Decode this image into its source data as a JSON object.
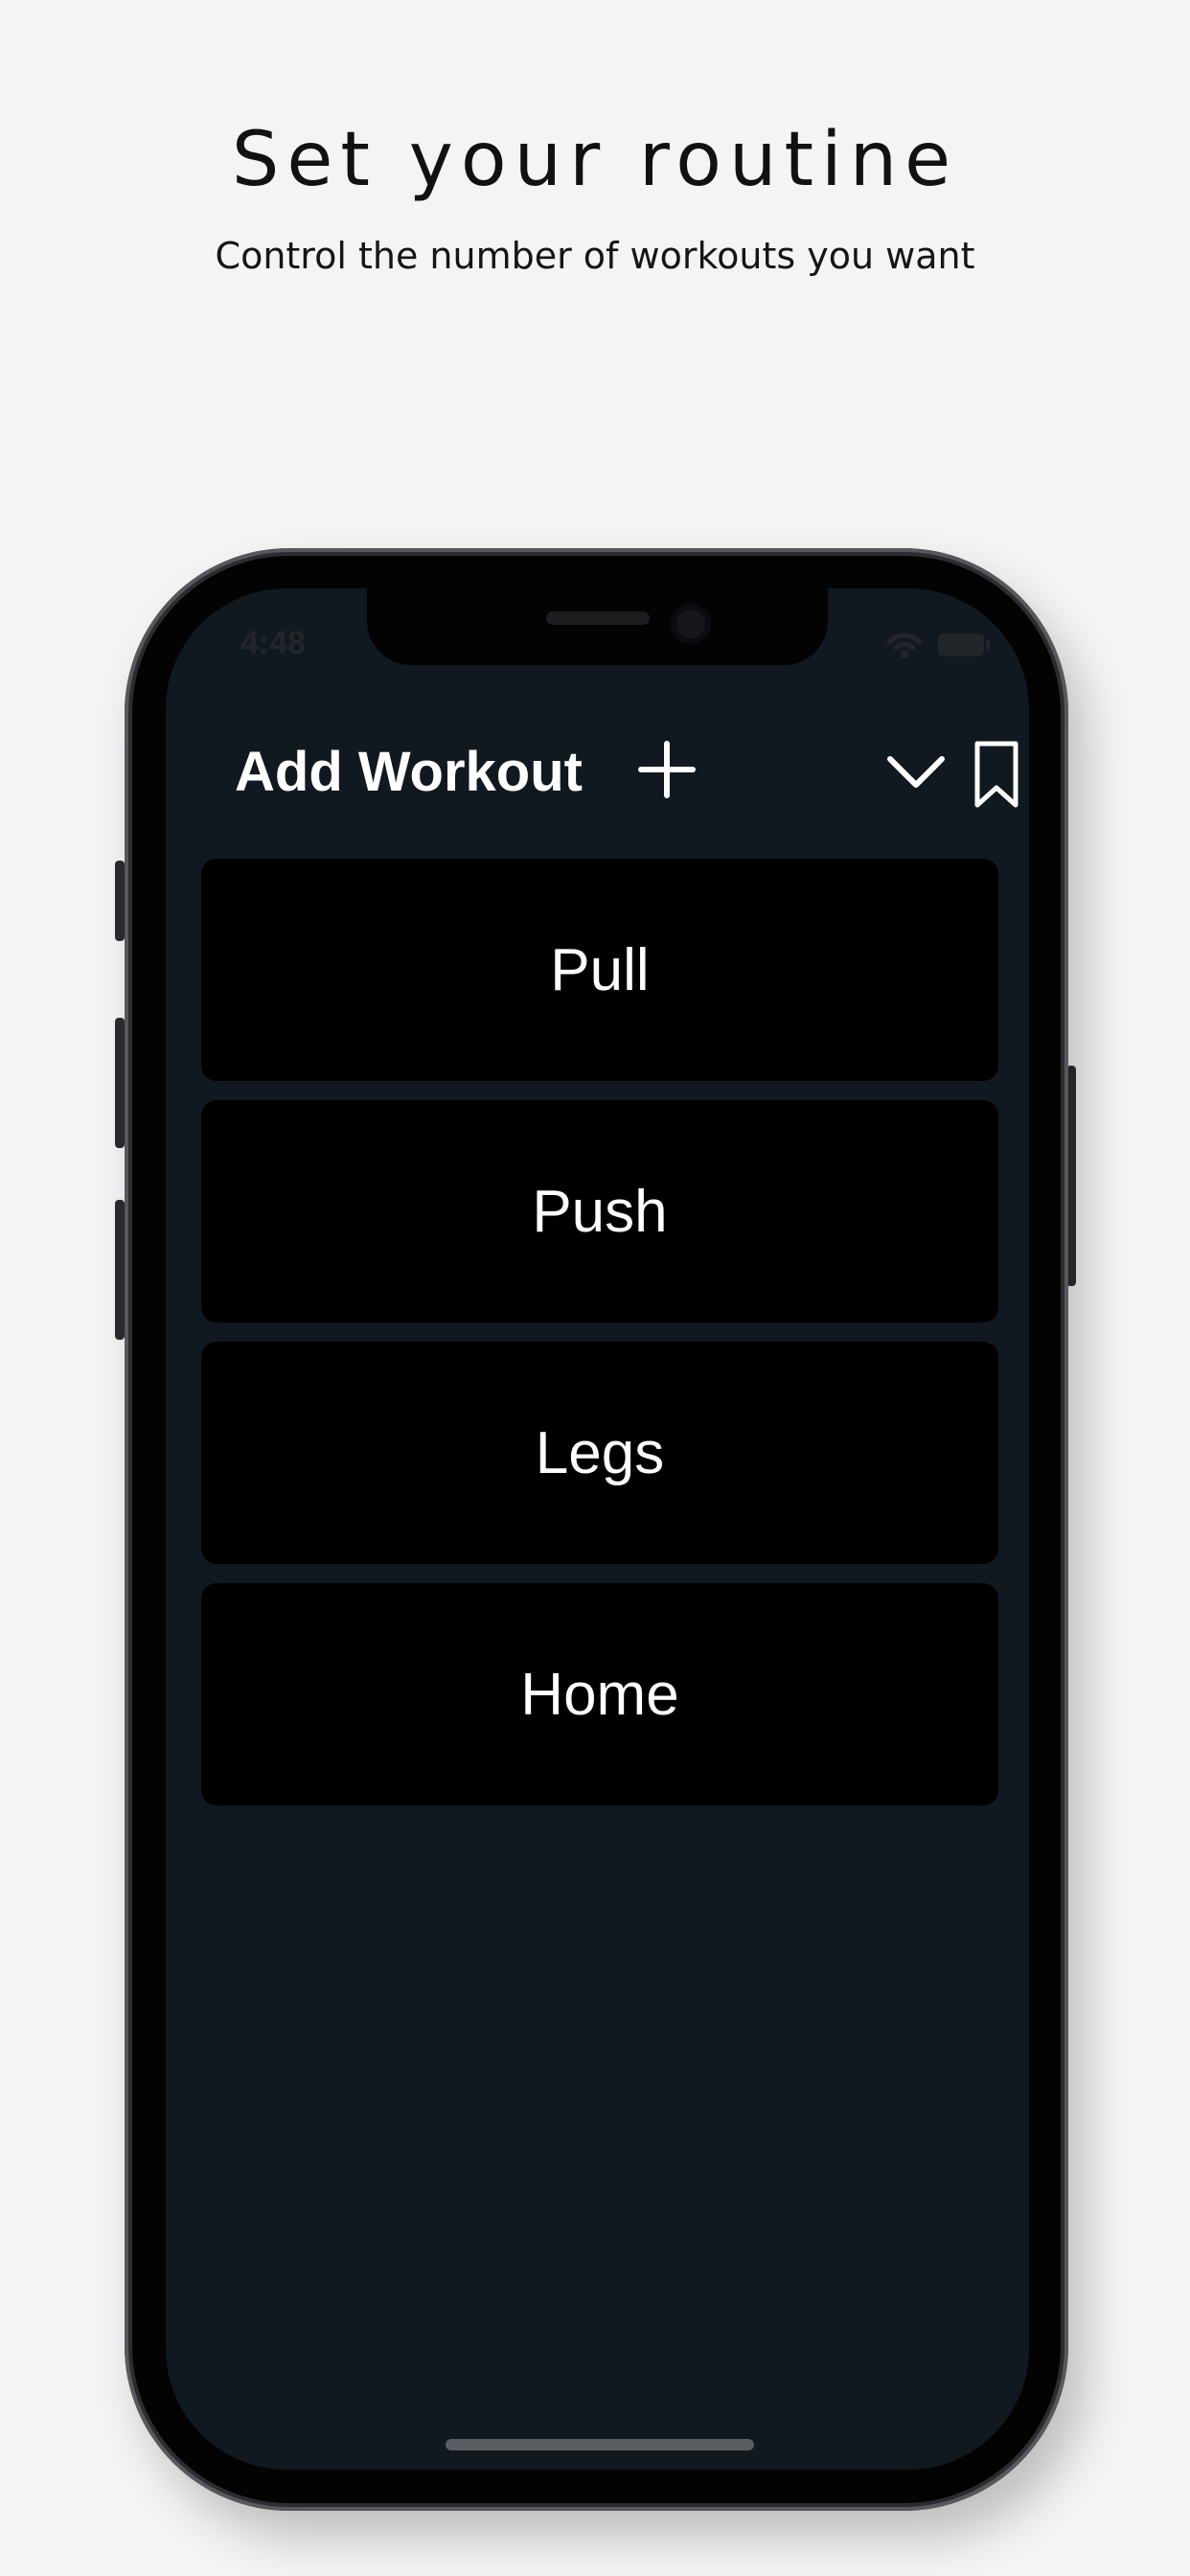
{
  "promo": {
    "headline": "Set your routine",
    "subhead": "Control the number of workouts you want"
  },
  "status_bar": {
    "time": "4:48",
    "icons": [
      "wifi-icon",
      "battery-icon"
    ]
  },
  "header": {
    "title": "Add Workout",
    "icons": [
      "plus-icon",
      "chevron-down-icon",
      "bookmark-icon"
    ]
  },
  "workouts": [
    {
      "label": "Pull"
    },
    {
      "label": "Push"
    },
    {
      "label": "Legs"
    },
    {
      "label": "Home"
    }
  ],
  "colors": {
    "background": "#f4f4f4",
    "screen": "#101820",
    "card": "#000000",
    "text": "#ffffff"
  }
}
